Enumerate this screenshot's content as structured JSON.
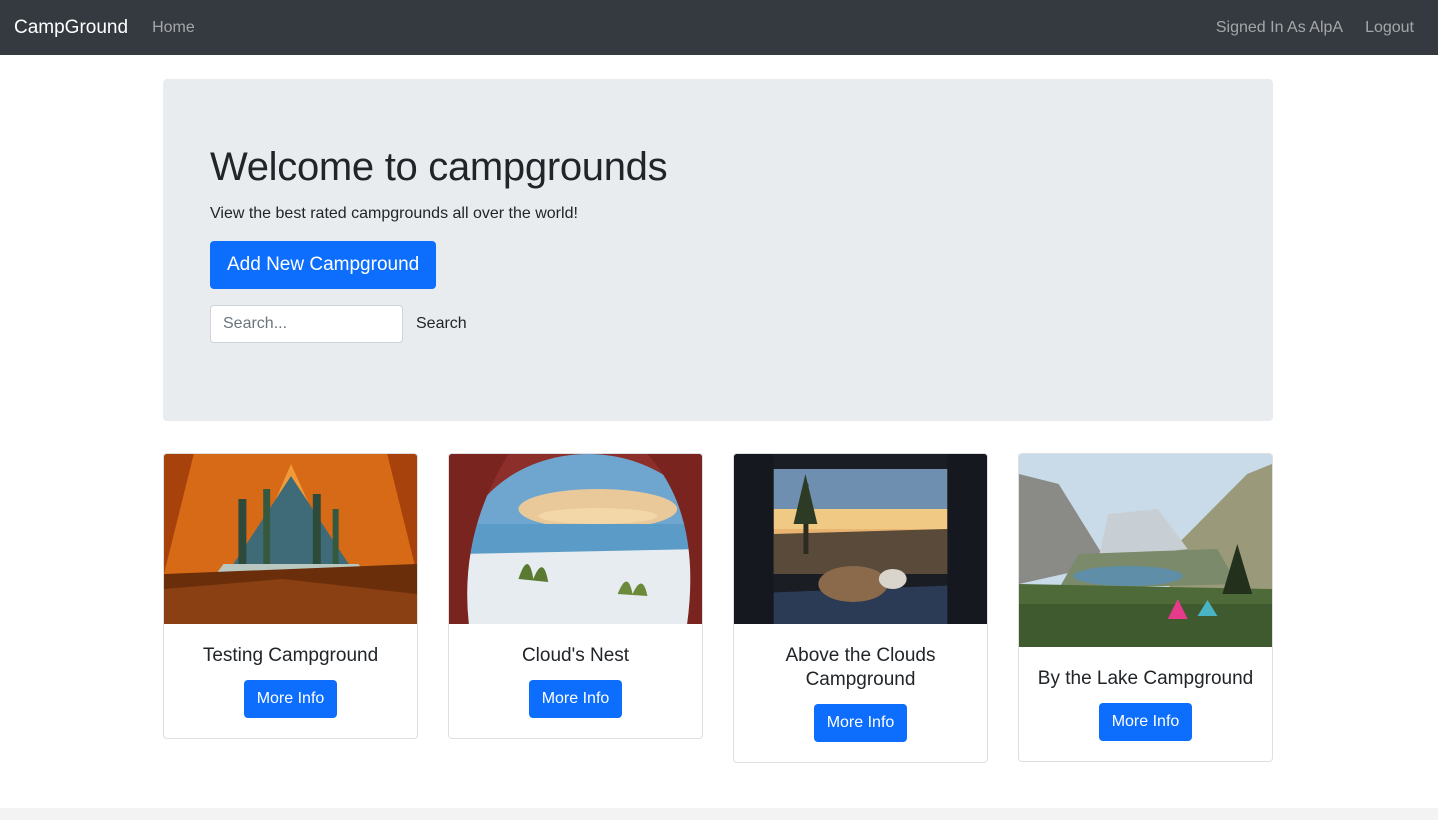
{
  "navbar": {
    "brand": "CampGround",
    "home": "Home",
    "signed_in": "Signed In As AlpA",
    "logout": "Logout"
  },
  "jumbotron": {
    "title": "Welcome to campgrounds",
    "subtitle": "View the best rated campgrounds all over the world!",
    "add_button": "Add New Campground",
    "search_placeholder": "Search...",
    "search_button": "Search"
  },
  "cards": [
    {
      "title": "Testing Campground",
      "button": "More Info",
      "image": "tent-forest-view"
    },
    {
      "title": "Cloud's Nest",
      "button": "More Info",
      "image": "tent-beach-view"
    },
    {
      "title": "Above the Clouds Campground",
      "button": "More Info",
      "image": "van-sunset-view"
    },
    {
      "title": "By the Lake Campground",
      "button": "More Info",
      "image": "mountain-lake-tents"
    }
  ],
  "colors": {
    "navbar": "#343a40",
    "primary": "#0d6efd",
    "jumbotron": "#e9ecef"
  }
}
